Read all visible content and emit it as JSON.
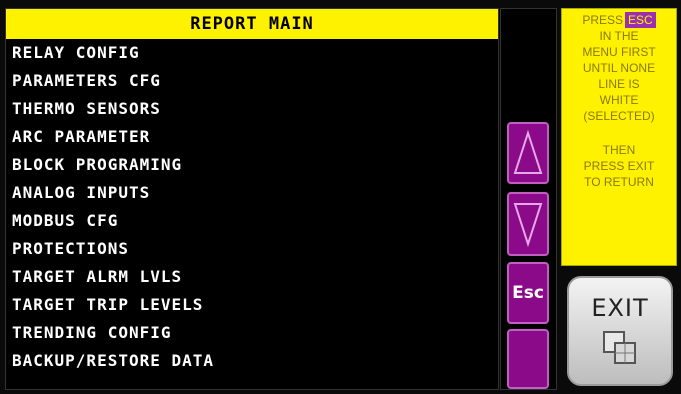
{
  "menu": {
    "title": "REPORT MAIN",
    "items": [
      "RELAY CONFIG",
      "PARAMETERS CFG",
      "THERMO SENSORS",
      "ARC PARAMETER",
      "BLOCK PROGRAMING",
      "ANALOG INPUTS",
      "MODBUS CFG",
      "PROTECTIONS",
      "TARGET ALRM LVLS",
      "TARGET TRIP LEVELS",
      "TRENDING CONFIG",
      "BACKUP/RESTORE DATA"
    ]
  },
  "scroll": {
    "up_icon": "triangle-up-icon",
    "down_icon": "triangle-down-icon",
    "esc_label": "Esc"
  },
  "help": {
    "press": "PRESS",
    "esc": "ESC",
    "lines": [
      "IN THE",
      "MENU FIRST",
      "UNTIL NONE",
      "LINE IS",
      "WHITE",
      "(SELECTED)"
    ],
    "lines2": [
      "THEN",
      "PRESS EXIT",
      "TO RETURN"
    ]
  },
  "exit": {
    "label": "EXIT"
  },
  "colors": {
    "title_bg": "#fff200",
    "button_purple": "#8a0a8a",
    "help_bg": "#fff200"
  }
}
